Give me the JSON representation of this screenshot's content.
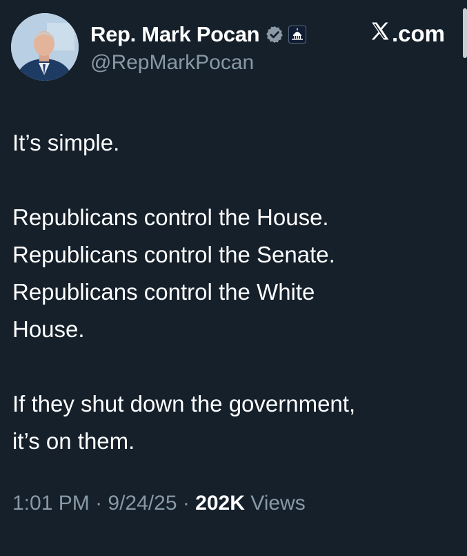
{
  "tweet": {
    "author": {
      "display_name": "Rep. Mark Pocan",
      "handle": "@RepMarkPocan"
    },
    "source": {
      "label": ".com",
      "icon": "x-logo-icon"
    },
    "body": {
      "line1": "It’s simple.",
      "paragraph2": "Republicans control the House.\nRepublicans control the Senate.\nRepublicans control the White\nHouse.",
      "paragraph3": "If they shut down the government,\nit’s on them."
    },
    "meta": {
      "time": "1:01 PM",
      "sep1": " · ",
      "date": "9/24/25",
      "sep2": " · ",
      "views_count": "202K",
      "views_label": " Views"
    },
    "icons": {
      "verified": "verified-badge-icon",
      "affiliation": "capitol-affiliation-icon"
    },
    "colors": {
      "background": "#15202b",
      "text": "#ffffff",
      "secondary_text": "#8899a6",
      "verified": "#8b98a5"
    }
  }
}
